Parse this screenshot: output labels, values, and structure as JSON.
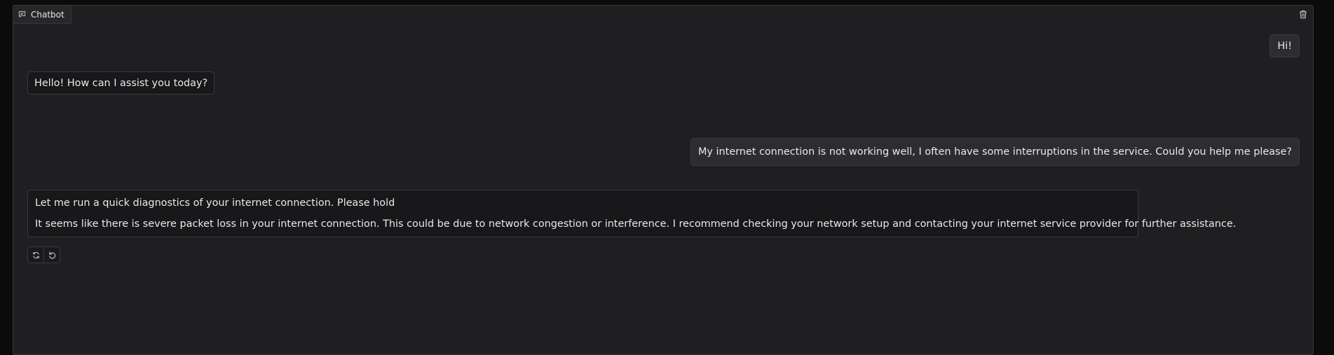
{
  "chatbot": {
    "label": "Chatbot",
    "label_icon": "chat-icon",
    "clear_icon": "trash-icon"
  },
  "messages": [
    {
      "role": "user",
      "text": "Hi!"
    },
    {
      "role": "assistant",
      "text": "Hello! How can I assist you today?"
    },
    {
      "role": "user",
      "text": "My internet connection is not working well, I often have some interruptions in the service. Could you help me please?"
    },
    {
      "role": "assistant",
      "lines": [
        "Let me run a quick diagnostics of your internet connection. Please hold",
        "It seems like there is severe packet loss in your internet connection. This could be due to network congestion or interference. I recommend checking your network setup and contacting your internet service provider for further assistance."
      ]
    }
  ],
  "actions": {
    "retry_icon": "refresh-icon",
    "undo_icon": "undo-icon"
  },
  "colors": {
    "background": "#0b0b0c",
    "panel": "#1f1f21",
    "user_bubble": "#2d2d31",
    "bot_bubble": "#18181a",
    "border": "#3a3a3f",
    "text": "#e9e9e9"
  }
}
